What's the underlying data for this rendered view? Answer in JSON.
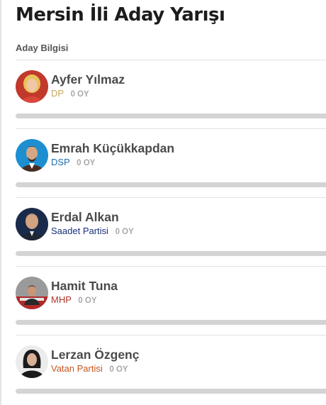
{
  "page": {
    "title": "Mersin İli Aday Yarışı",
    "section_label": "Aday Bilgisi"
  },
  "candidates": [
    {
      "name": "Ayfer Yılmaz",
      "party": "DP",
      "party_color": "#c9a55a",
      "votes": "0 OY",
      "vote_share": 0,
      "avatar_bg": "#c0392b"
    },
    {
      "name": "Emrah Küçükkapdan",
      "party": "DSP",
      "party_color": "#1f6fb0",
      "votes": "0 OY",
      "vote_share": 0,
      "avatar_bg": "#1d8fd1"
    },
    {
      "name": "Erdal Alkan",
      "party": "Saadet Partisi",
      "party_color": "#1a2f7a",
      "votes": "0 OY",
      "vote_share": 0,
      "avatar_bg": "#1a2a4a"
    },
    {
      "name": "Hamit Tuna",
      "party": "MHP",
      "party_color": "#b2322a",
      "votes": "0 OY",
      "vote_share": 0,
      "avatar_bg": "#8a8a8a"
    },
    {
      "name": "Lerzan Özgenç",
      "party": "Vatan Partisi",
      "party_color": "#c8551c",
      "votes": "0 OY",
      "vote_share": 0,
      "avatar_bg": "#e8e8e8"
    }
  ]
}
